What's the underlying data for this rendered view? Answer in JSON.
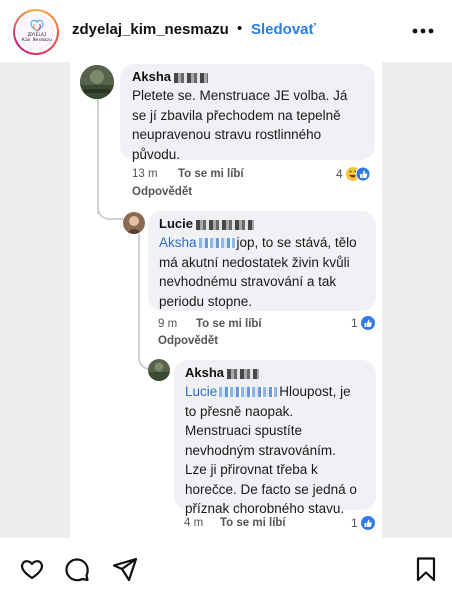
{
  "header": {
    "avatar_logo_text": "ZDYELAJ\nKim Nesmazu",
    "username": "zdyelaj_kim_nesmazu",
    "separator": "•",
    "follow_label": "Sledovať"
  },
  "comments": [
    {
      "author": "Aksha",
      "text": "Pletete se. Menstruace JE volba. Já se jí zbavila přechodem na tepelně neupravenou stravu rostlinného původu.",
      "lines": [
        "Pletete se. Menstruace JE volba. Já",
        "se jí zbavila přechodem na tepelně",
        "neupravenou stravu rostlinného",
        "původu."
      ],
      "time": "13 m",
      "like_label": "To se mi líbí",
      "reply_label": "Odpovědět",
      "reaction_count": "4"
    },
    {
      "author": "Lucie",
      "mention": "Aksha",
      "lines_after_mention": "jop, to se stává, tělo",
      "lines": [
        "má akutní nedostatek živin kvůli",
        "nevhodnému stravování a tak",
        "periodu stopne."
      ],
      "time": "9 m",
      "like_label": "To se mi líbí",
      "reply_label": "Odpovědět",
      "reaction_count": "1"
    },
    {
      "author": "Aksha",
      "mention": "Lucie",
      "lines_after_mention": "Hloupost, je",
      "lines": [
        "to přesně naopak.",
        "Menstruaci spustíte",
        "nevhodným stravováním.",
        "Lze ji přirovnat třeba k",
        "horečce.  De facto se jedná o",
        "příznak chorobného stavu."
      ],
      "time": "4 m",
      "like_label": "To se mi líbí",
      "reaction_count": "1"
    }
  ],
  "actions": {
    "like": "heart-icon",
    "comment": "comment-icon",
    "share": "send-icon",
    "save": "bookmark-icon"
  },
  "colors": {
    "accent": "#2b7de1",
    "mention": "#2f6dc4",
    "bubble": "#f0f1f4"
  }
}
